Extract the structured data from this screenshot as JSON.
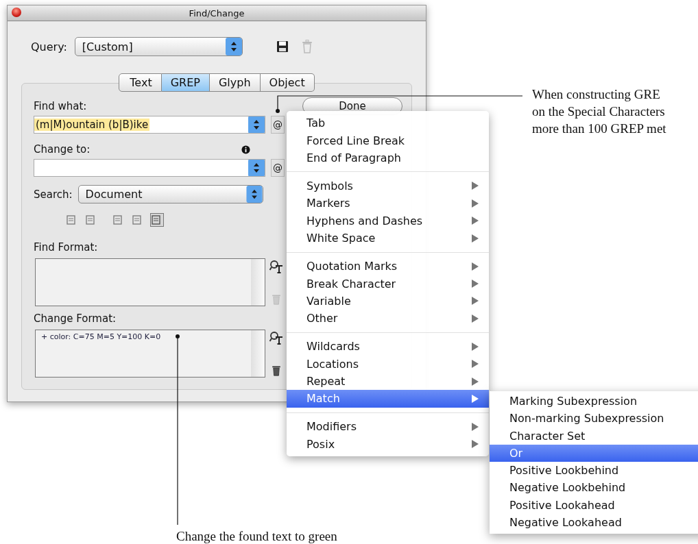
{
  "window": {
    "title": "Find/Change"
  },
  "query": {
    "label": "Query:",
    "value": "[Custom]"
  },
  "tabs": [
    {
      "label": "Text",
      "selected": false
    },
    {
      "label": "GREP",
      "selected": true
    },
    {
      "label": "Glyph",
      "selected": false
    },
    {
      "label": "Object",
      "selected": false
    }
  ],
  "find_what": {
    "label": "Find what:",
    "value": "(m|M)ountain (b|B)ike",
    "button": "@"
  },
  "change_to": {
    "label": "Change to:",
    "button": "@"
  },
  "search": {
    "label": "Search:",
    "value": "Document"
  },
  "search_options": [
    {
      "on": false
    },
    {
      "on": false
    },
    {
      "on": false
    },
    {
      "on": false
    },
    {
      "on": true
    }
  ],
  "find_format": {
    "label": "Find Format:"
  },
  "change_format": {
    "label": "Change Format:",
    "value": "+ color: C=75 M=5 Y=100 K=0"
  },
  "done_button": "Done",
  "special_characters_menu": {
    "groups": [
      {
        "items": [
          {
            "label": "Tab",
            "has_submenu": false,
            "selected": false
          },
          {
            "label": "Forced Line Break",
            "has_submenu": false,
            "selected": false
          },
          {
            "label": "End of Paragraph",
            "has_submenu": false,
            "selected": false
          }
        ]
      },
      {
        "items": [
          {
            "label": "Symbols",
            "has_submenu": true,
            "selected": false
          },
          {
            "label": "Markers",
            "has_submenu": true,
            "selected": false
          },
          {
            "label": "Hyphens and Dashes",
            "has_submenu": true,
            "selected": false
          },
          {
            "label": "White Space",
            "has_submenu": true,
            "selected": false
          }
        ]
      },
      {
        "items": [
          {
            "label": "Quotation Marks",
            "has_submenu": true,
            "selected": false
          },
          {
            "label": "Break Character",
            "has_submenu": true,
            "selected": false
          },
          {
            "label": "Variable",
            "has_submenu": true,
            "selected": false
          },
          {
            "label": "Other",
            "has_submenu": true,
            "selected": false
          }
        ]
      },
      {
        "items": [
          {
            "label": "Wildcards",
            "has_submenu": true,
            "selected": false
          },
          {
            "label": "Locations",
            "has_submenu": true,
            "selected": false
          },
          {
            "label": "Repeat",
            "has_submenu": true,
            "selected": false
          },
          {
            "label": "Match",
            "has_submenu": true,
            "selected": true
          }
        ]
      },
      {
        "items": [
          {
            "label": "Modifiers",
            "has_submenu": true,
            "selected": false
          },
          {
            "label": "Posix",
            "has_submenu": true,
            "selected": false
          }
        ]
      }
    ]
  },
  "match_submenu": {
    "items": [
      {
        "label": "Marking Subexpression",
        "selected": false
      },
      {
        "label": "Non-marking Subexpression",
        "selected": false
      },
      {
        "label": "Character Set",
        "selected": false
      },
      {
        "label": "Or",
        "selected": true
      },
      {
        "label": "Positive Lookbehind",
        "selected": false
      },
      {
        "label": "Negative Lookbehind",
        "selected": false
      },
      {
        "label": "Positive Lookahead",
        "selected": false
      },
      {
        "label": "Negative Lookahead",
        "selected": false
      }
    ]
  },
  "top_callout": {
    "lines": [
      "When constructing GRE",
      "on the Special Characters",
      "more than 100 GREP met"
    ]
  },
  "bottom_callout": {
    "text": "Change the found text to green"
  }
}
